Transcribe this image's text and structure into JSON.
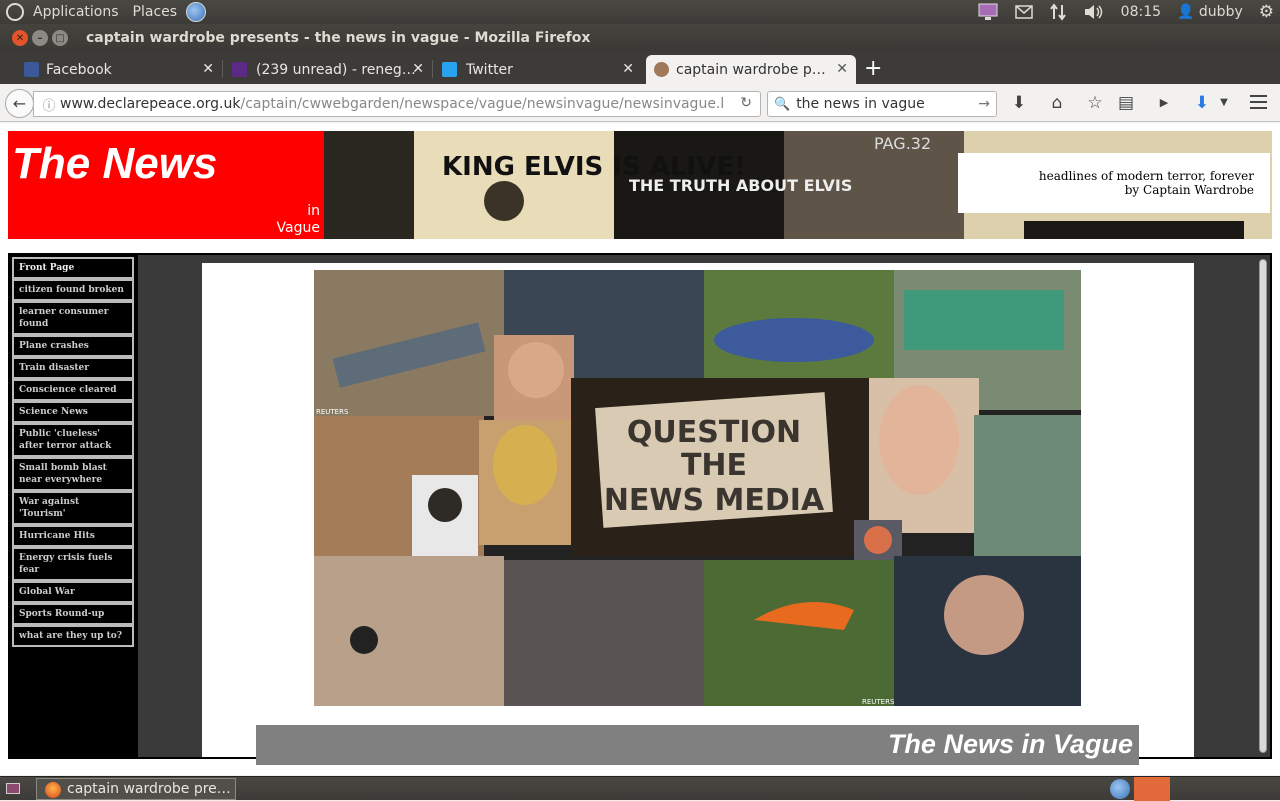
{
  "panel": {
    "applications": "Applications",
    "places": "Places",
    "clock": "08:15",
    "user": "dubby"
  },
  "window": {
    "title": "captain wardrobe presents - the news in vague - Mozilla Firefox"
  },
  "tabs": [
    {
      "label": "Facebook",
      "favicon_color": "#3b5998"
    },
    {
      "label": "(239 unread) - reneg…",
      "favicon_color": "#5b2a86"
    },
    {
      "label": "Twitter",
      "favicon_color": "#2aa3ef"
    },
    {
      "label": "captain wardrobe p…",
      "favicon_color": "#a0785a"
    }
  ],
  "nav": {
    "url_host": "www.declarepeace.org.uk",
    "url_path": "/captain/cwwebgarden/newspace/vague/newsinvague/newsinvague.l",
    "search_value": "the news in vague"
  },
  "page": {
    "logo_title": "The News",
    "logo_in": "in",
    "logo_vague": "Vague",
    "tagline_1": "headlines of modern terror, forever",
    "tagline_2": "by Captain Wardrobe",
    "banner_headline_1": "KING ELVIS IS ALIVE!",
    "banner_headline_2": "THE TRUTH ABOUT ELVIS",
    "banner_page": "PAG.32",
    "collage_sign": [
      "QUESTION",
      "THE",
      "NEWS MEDIA"
    ],
    "reuters_label": "REUTERS",
    "footer_title": "The News in Vague"
  },
  "sidebar": {
    "items": [
      "Front Page",
      "citizen found broken",
      "learner consumer found",
      "Plane crashes",
      "Train disaster",
      "Conscience cleared",
      "Science News",
      "Public 'clueless' after terror attack",
      "Small bomb blast near everywhere",
      "War against 'Tourism'",
      "Hurricane Hits",
      "Energy crisis fuels fear",
      "Global War",
      "Sports Round-up",
      "what are they up to?"
    ]
  },
  "taskbar": {
    "task_label": "captain wardrobe pre…"
  },
  "colors": {
    "logo_red": "#ff0000",
    "panel": "#3c3b37",
    "close_button": "#e2542c"
  }
}
